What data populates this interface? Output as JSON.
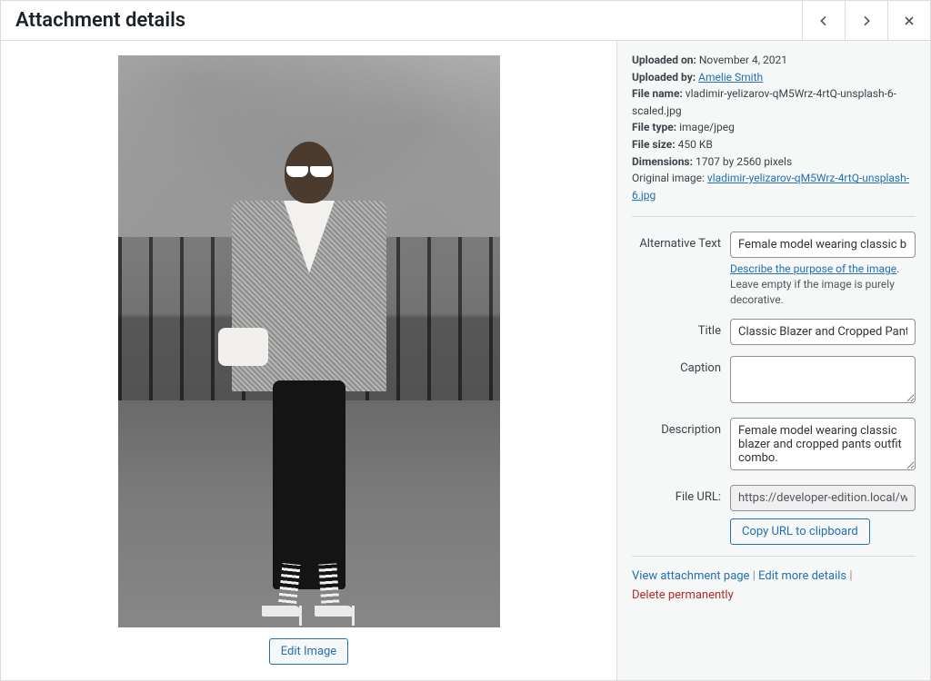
{
  "header": {
    "title": "Attachment details"
  },
  "meta": {
    "uploaded_on_label": "Uploaded on:",
    "uploaded_on": "November 4, 2021",
    "uploaded_by_label": "Uploaded by:",
    "uploaded_by": "Amelie Smith",
    "file_name_label": "File name:",
    "file_name": "vladimir-yelizarov-qM5Wrz-4rtQ-unsplash-6-scaled.jpg",
    "file_type_label": "File type:",
    "file_type": "image/jpeg",
    "file_size_label": "File size:",
    "file_size": "450 KB",
    "dimensions_label": "Dimensions:",
    "dimensions": "1707 by 2560 pixels",
    "original_label": "Original image:",
    "original_link": "vladimir-yelizarov-qM5Wrz-4rtQ-unsplash-6.jpg"
  },
  "fields": {
    "alt_label": "Alternative Text",
    "alt_value": "Female model wearing classic blazer and cropped pants outfit combo.",
    "alt_help_link": "Describe the purpose of the image",
    "alt_help_tail": ". Leave empty if the image is purely decorative.",
    "title_label": "Title",
    "title_value": "Classic Blazer and Cropped Pants Outfit",
    "caption_label": "Caption",
    "caption_value": "",
    "description_label": "Description",
    "description_value": "Female model wearing classic blazer and cropped pants outfit combo.",
    "fileurl_label": "File URL:",
    "fileurl_value": "https://developer-edition.local/wp-content/uploads/...",
    "copy_label": "Copy URL to clipboard"
  },
  "actions": {
    "view": "View attachment page",
    "edit_more": "Edit more details",
    "delete": "Delete permanently",
    "edit_image": "Edit Image"
  }
}
